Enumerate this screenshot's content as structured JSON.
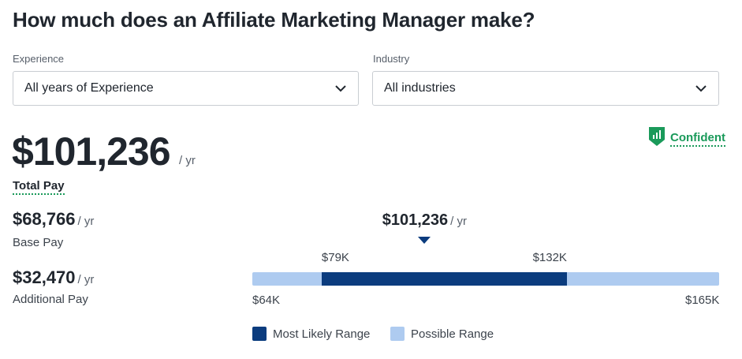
{
  "title": "How much does an Affiliate Marketing Manager make?",
  "filters": {
    "experience": {
      "label": "Experience",
      "value": "All years of Experience"
    },
    "industry": {
      "label": "Industry",
      "value": "All industries"
    }
  },
  "confidence": {
    "label": "Confident",
    "color": "#1a9a5a"
  },
  "total_pay": {
    "amount": "$101,236",
    "unit": "/ yr",
    "label": "Total Pay"
  },
  "base_pay": {
    "amount": "$68,766",
    "unit": "/ yr",
    "label": "Base Pay"
  },
  "additional_pay": {
    "amount": "$32,470",
    "unit": "/ yr",
    "label": "Additional Pay"
  },
  "range": {
    "median_label": "$101,236",
    "median_unit": "/ yr",
    "median_value": 101236,
    "min": 64000,
    "max": 165000,
    "likely_low": 79000,
    "likely_high": 132000,
    "min_label": "$64K",
    "max_label": "$165K",
    "likely_low_label": "$79K",
    "likely_high_label": "$132K",
    "colors": {
      "likely": "#0b3c7e",
      "possible": "#aecbf0"
    }
  },
  "legend": {
    "likely": "Most Likely Range",
    "possible": "Possible Range"
  }
}
